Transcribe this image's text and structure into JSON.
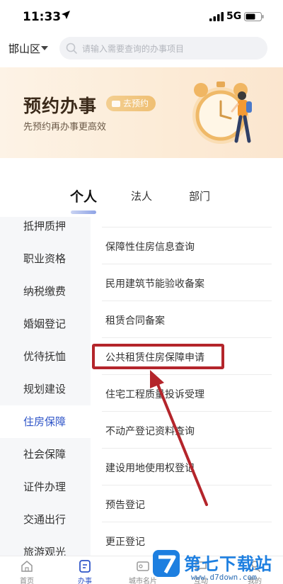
{
  "status_bar": {
    "time": "11:33",
    "network": "5G"
  },
  "location": {
    "district": "邯山区"
  },
  "search": {
    "placeholder": "请输入需要查询的办事项目"
  },
  "banner": {
    "title": "预约办事",
    "subtitle": "先预约再办事更高效",
    "cta_label": "去预约"
  },
  "tabs": [
    {
      "label": "个人",
      "active": true
    },
    {
      "label": "法人",
      "active": false
    },
    {
      "label": "部门",
      "active": false
    }
  ],
  "categories": [
    {
      "label": "抵押质押"
    },
    {
      "label": "职业资格"
    },
    {
      "label": "纳税缴费"
    },
    {
      "label": "婚姻登记"
    },
    {
      "label": "优待抚恤"
    },
    {
      "label": "规划建设"
    },
    {
      "label": "住房保障",
      "active": true
    },
    {
      "label": "社会保障"
    },
    {
      "label": "证件办理"
    },
    {
      "label": "交通出行"
    },
    {
      "label": "旅游观光"
    }
  ],
  "items": [
    {
      "label": "保障性住房信息查询"
    },
    {
      "label": "民用建筑节能验收备案"
    },
    {
      "label": "租赁合同备案"
    },
    {
      "label": "公共租赁住房保障申请",
      "highlighted": true
    },
    {
      "label": "住宅工程质量投诉受理"
    },
    {
      "label": "不动产登记资料查询"
    },
    {
      "label": "建设用地使用权登记"
    },
    {
      "label": "预告登记"
    },
    {
      "label": "更正登记"
    }
  ],
  "bottom_nav": [
    {
      "label": "首页",
      "icon": "home-icon"
    },
    {
      "label": "办事",
      "icon": "service-icon",
      "active": true
    },
    {
      "label": "城市名片",
      "icon": "city-card-icon"
    },
    {
      "label": "互动",
      "icon": "interact-icon"
    },
    {
      "label": "我的",
      "icon": "profile-icon"
    }
  ],
  "watermark": {
    "text": "第七下载站",
    "url": "www.d7down.com"
  },
  "colors": {
    "accent": "#2f55c8",
    "highlight": "#b4252b",
    "banner_bg": "#fdf3e6"
  }
}
